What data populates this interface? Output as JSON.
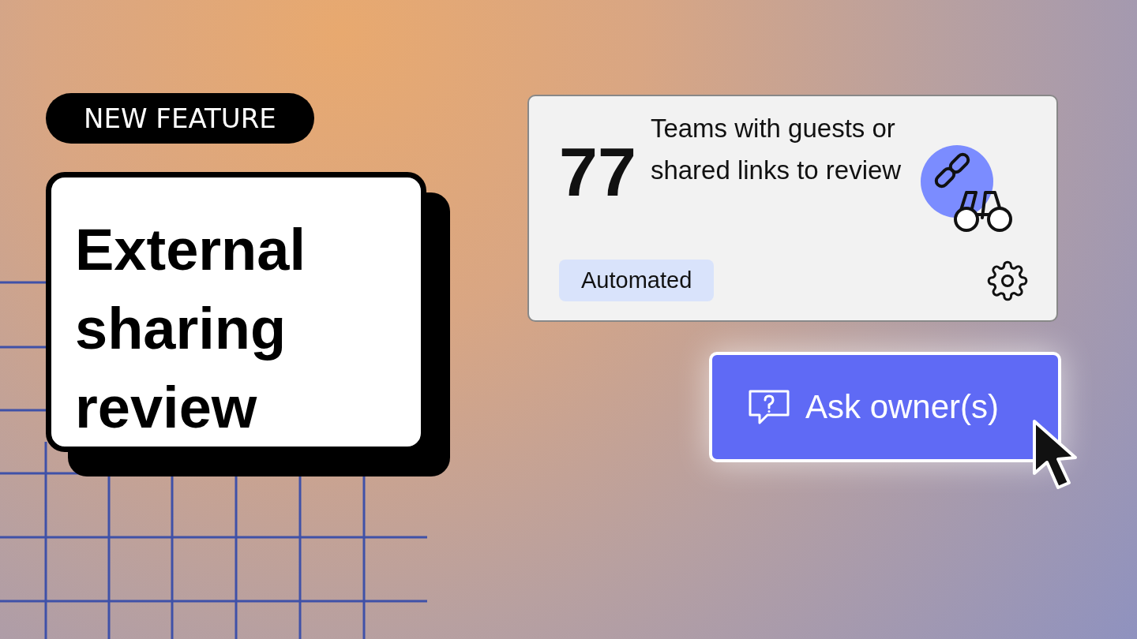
{
  "badge": "NEW FEATURE",
  "title": "External sharing review",
  "card": {
    "count": "77",
    "description": "Teams with guests or shared links to review",
    "tag": "Automated"
  },
  "button": {
    "label": "Ask owner(s)"
  }
}
